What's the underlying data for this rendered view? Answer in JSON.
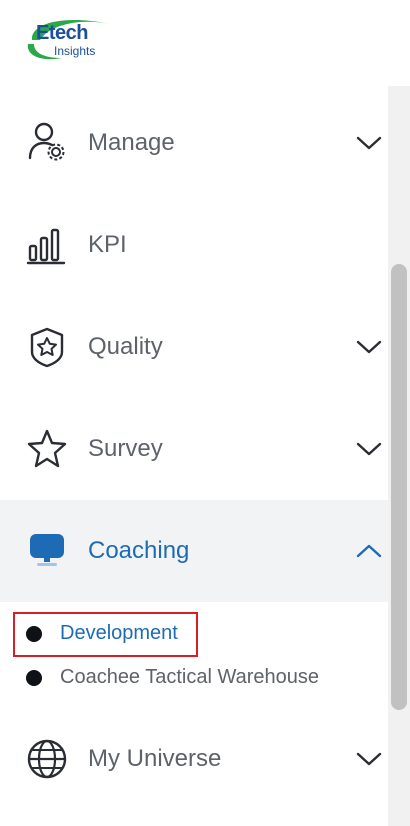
{
  "logo": {
    "line1": "Etech",
    "line2": "Insights"
  },
  "nav": {
    "manage": {
      "label": "Manage",
      "icon": "user-settings-icon"
    },
    "kpi": {
      "label": "KPI",
      "icon": "bar-chart-icon"
    },
    "quality": {
      "label": "Quality",
      "icon": "shield-badge-icon"
    },
    "survey": {
      "label": "Survey",
      "icon": "star-icon"
    },
    "coaching": {
      "label": "Coaching",
      "icon": "monitor-icon",
      "expanded": true,
      "children": [
        {
          "label": "Development",
          "active": true
        },
        {
          "label": "Coachee Tactical Warehouse",
          "active": false
        }
      ]
    },
    "my_universe": {
      "label": "My Universe",
      "icon": "globe-icon"
    }
  },
  "colors": {
    "active_text": "#1e6bb5",
    "text": "#5e6269",
    "active_bg": "#f2f3f5",
    "highlight_border": "#d71f2c"
  }
}
